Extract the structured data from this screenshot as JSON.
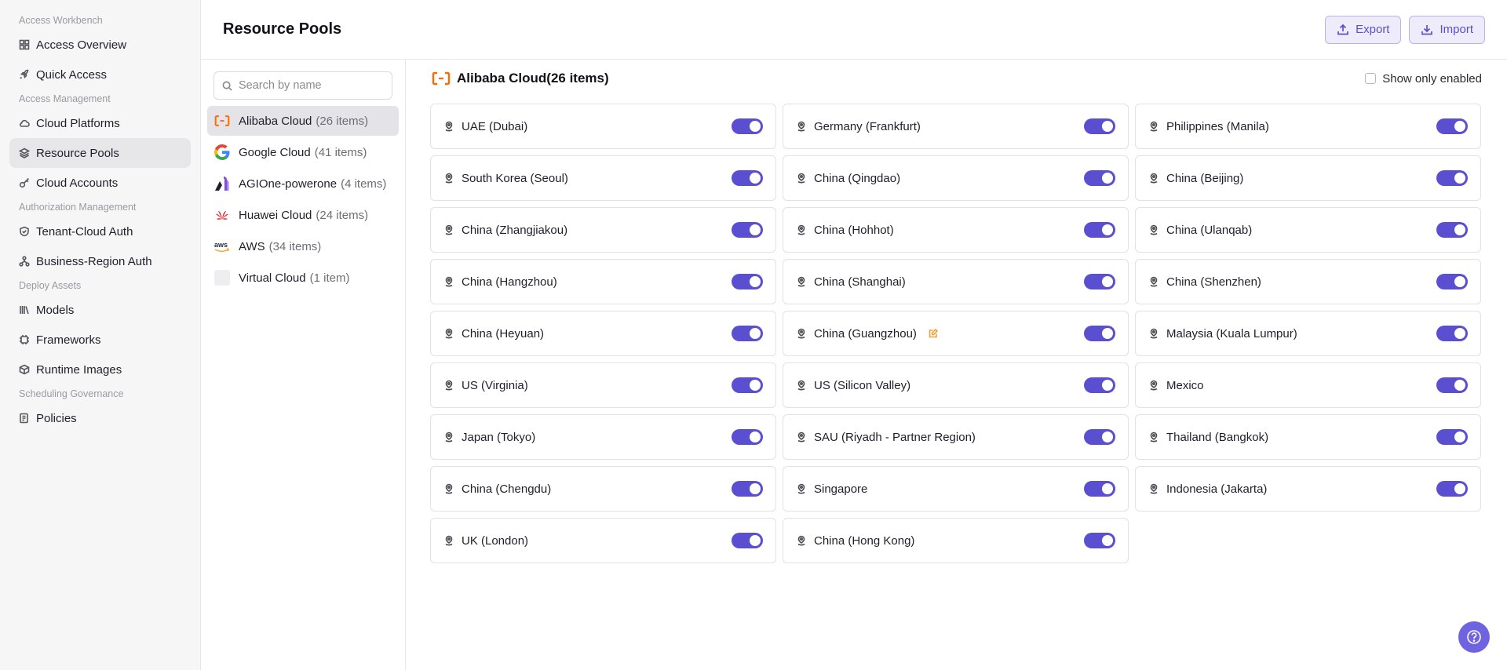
{
  "sidebar": {
    "groups": [
      {
        "label": "Access Workbench",
        "items": [
          {
            "label": "Access Overview",
            "icon": "grid-icon"
          },
          {
            "label": "Quick Access",
            "icon": "rocket-icon"
          }
        ]
      },
      {
        "label": "Access Management",
        "items": [
          {
            "label": "Cloud Platforms",
            "icon": "cloud-icon"
          },
          {
            "label": "Resource Pools",
            "icon": "layers-icon",
            "active": true
          },
          {
            "label": "Cloud Accounts",
            "icon": "key-icon"
          }
        ]
      },
      {
        "label": "Authorization Management",
        "items": [
          {
            "label": "Tenant-Cloud Auth",
            "icon": "shield-icon"
          },
          {
            "label": "Business-Region Auth",
            "icon": "sitemap-icon"
          }
        ]
      },
      {
        "label": "Deploy Assets",
        "items": [
          {
            "label": "Models",
            "icon": "library-icon"
          },
          {
            "label": "Frameworks",
            "icon": "chip-icon"
          },
          {
            "label": "Runtime Images",
            "icon": "box-icon"
          }
        ]
      },
      {
        "label": "Scheduling Governance",
        "items": [
          {
            "label": "Policies",
            "icon": "policy-icon"
          }
        ]
      }
    ]
  },
  "header": {
    "title": "Resource Pools",
    "export_label": "Export",
    "import_label": "Import"
  },
  "providers": {
    "search_placeholder": "Search by name",
    "items": [
      {
        "name": "Alibaba Cloud",
        "count": "(26 items)",
        "logo": "alibaba-logo",
        "active": true
      },
      {
        "name": "Google Cloud",
        "count": "(41 items)",
        "logo": "google-logo"
      },
      {
        "name": "AGIOne-powerone",
        "count": "(4 items)",
        "logo": "agione-logo"
      },
      {
        "name": "Huawei Cloud",
        "count": "(24 items)",
        "logo": "huawei-logo"
      },
      {
        "name": "AWS",
        "count": "(34 items)",
        "logo": "aws-logo"
      },
      {
        "name": "Virtual Cloud",
        "count": "(1 item)",
        "logo": "placeholder-logo"
      }
    ]
  },
  "main": {
    "section_title": "Alibaba Cloud(26 items)",
    "show_only_enabled_label": "Show only enabled",
    "regions": [
      {
        "name": "UAE (Dubai)",
        "enabled": true
      },
      {
        "name": "Germany (Frankfurt)",
        "enabled": true
      },
      {
        "name": "Philippines (Manila)",
        "enabled": true
      },
      {
        "name": "South Korea (Seoul)",
        "enabled": true
      },
      {
        "name": "China (Qingdao)",
        "enabled": true
      },
      {
        "name": "China (Beijing)",
        "enabled": true
      },
      {
        "name": "China (Zhangjiakou)",
        "enabled": true
      },
      {
        "name": "China (Hohhot)",
        "enabled": true
      },
      {
        "name": "China (Ulanqab)",
        "enabled": true
      },
      {
        "name": "China (Hangzhou)",
        "enabled": true
      },
      {
        "name": "China (Shanghai)",
        "enabled": true
      },
      {
        "name": "China (Shenzhen)",
        "enabled": true
      },
      {
        "name": "China (Heyuan)",
        "enabled": true
      },
      {
        "name": "China (Guangzhou)",
        "enabled": true,
        "edited": true
      },
      {
        "name": "Malaysia (Kuala Lumpur)",
        "enabled": true
      },
      {
        "name": "US (Virginia)",
        "enabled": true
      },
      {
        "name": "US (Silicon Valley)",
        "enabled": true
      },
      {
        "name": "Mexico",
        "enabled": true
      },
      {
        "name": "Japan (Tokyo)",
        "enabled": true
      },
      {
        "name": "SAU (Riyadh - Partner Region)",
        "enabled": true
      },
      {
        "name": "Thailand (Bangkok)",
        "enabled": true
      },
      {
        "name": "China (Chengdu)",
        "enabled": true
      },
      {
        "name": "Singapore",
        "enabled": true
      },
      {
        "name": "Indonesia (Jakarta)",
        "enabled": true
      },
      {
        "name": "UK (London)",
        "enabled": true
      },
      {
        "name": "China (Hong Kong)",
        "enabled": true
      }
    ]
  },
  "colors": {
    "accent": "#5b4fd1",
    "alibaba": "#ff6a00",
    "edit": "#e8a43a"
  }
}
